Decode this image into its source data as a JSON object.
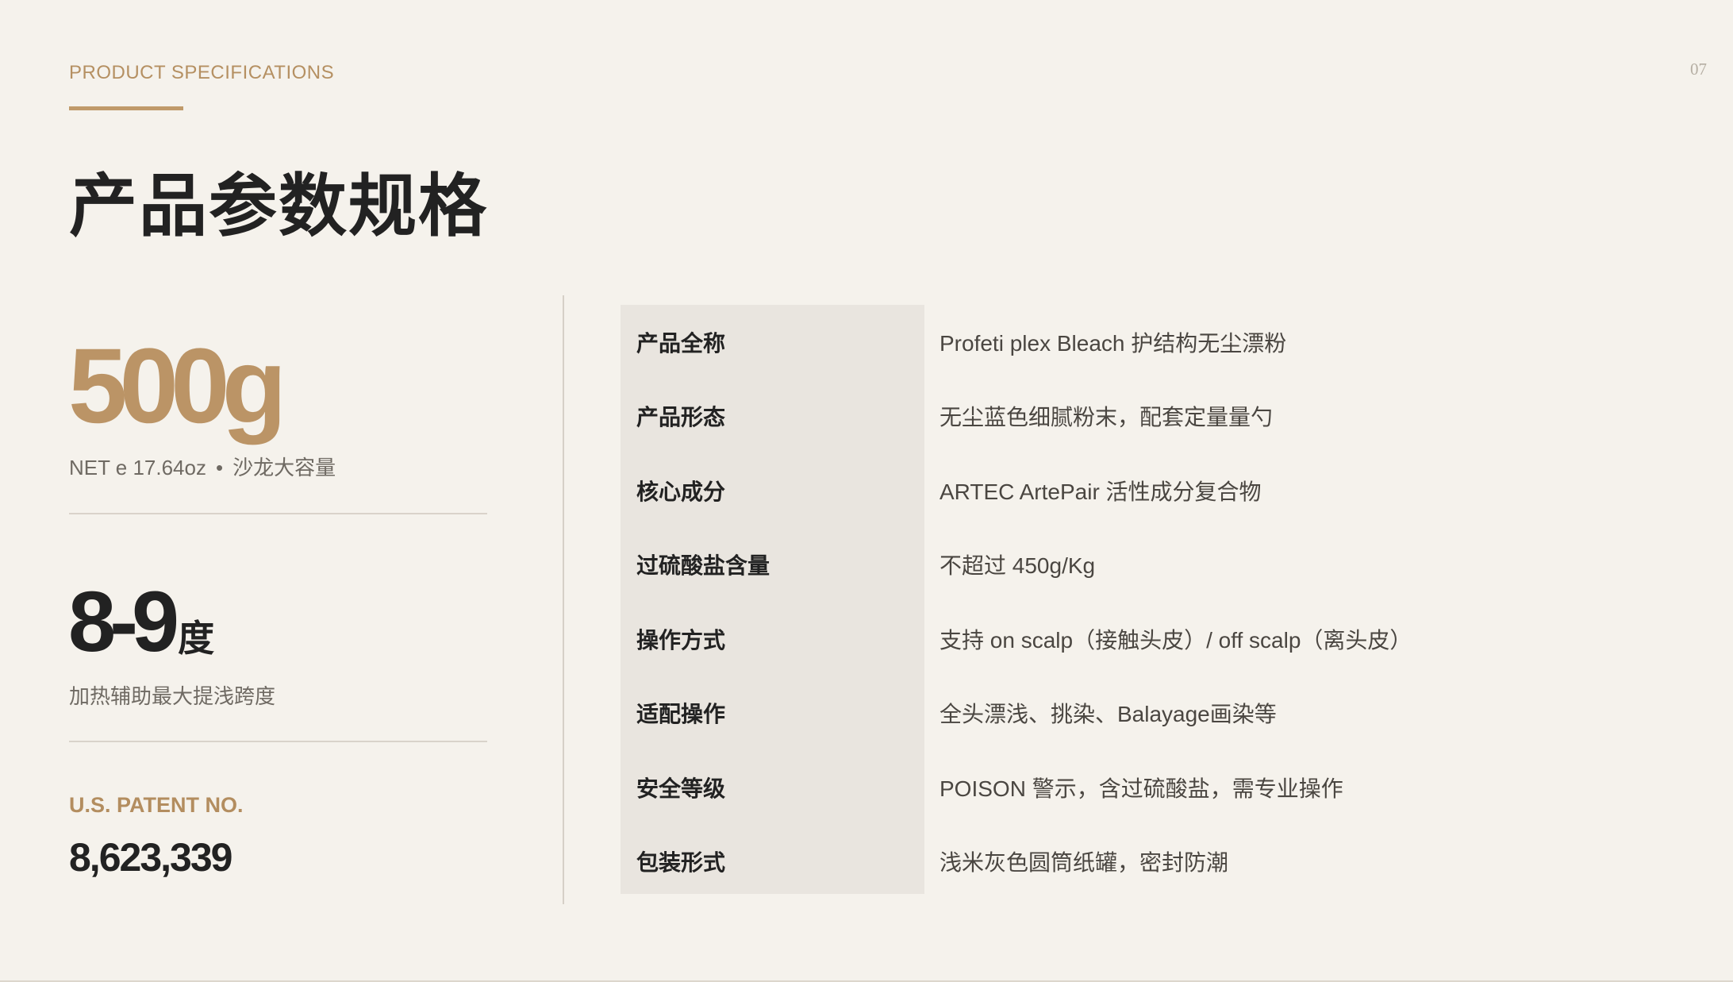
{
  "header": {
    "eyebrow": "PRODUCT SPECIFICATIONS",
    "page_number": "07",
    "title": "产品参数规格"
  },
  "highlights": {
    "weight": {
      "value": "500g",
      "net": "NET e 17.64oz",
      "separator": "•",
      "note": "沙龙大容量"
    },
    "lift": {
      "value": "8-9",
      "unit": "度",
      "note": "加热辅助最大提浅跨度"
    },
    "patent": {
      "label": "U.S. PATENT NO.",
      "number": "8,623,339"
    }
  },
  "specs": [
    {
      "label": "产品全称",
      "value": "Profeti plex Bleach 护结构无尘漂粉"
    },
    {
      "label": "产品形态",
      "value": "无尘蓝色细腻粉末，配套定量量勺"
    },
    {
      "label": "核心成分",
      "value": "ARTEC ArtePair 活性成分复合物"
    },
    {
      "label": "过硫酸盐含量",
      "value": "不超过 450g/Kg"
    },
    {
      "label": "操作方式",
      "value": "支持 on scalp（接触头皮）/ off scalp（离头皮）"
    },
    {
      "label": "适配操作",
      "value": "全头漂浅、挑染、Balayage画染等"
    },
    {
      "label": "安全等级",
      "value": "POISON 警示，含过硫酸盐，需专业操作"
    },
    {
      "label": "包装形式",
      "value": "浅米灰色圆筒纸罐，密封防潮"
    }
  ],
  "colors": {
    "background": "#f5f2ec",
    "accent": "#bb9466",
    "label_panel": "#e9e5df",
    "text_dark": "#222222"
  }
}
